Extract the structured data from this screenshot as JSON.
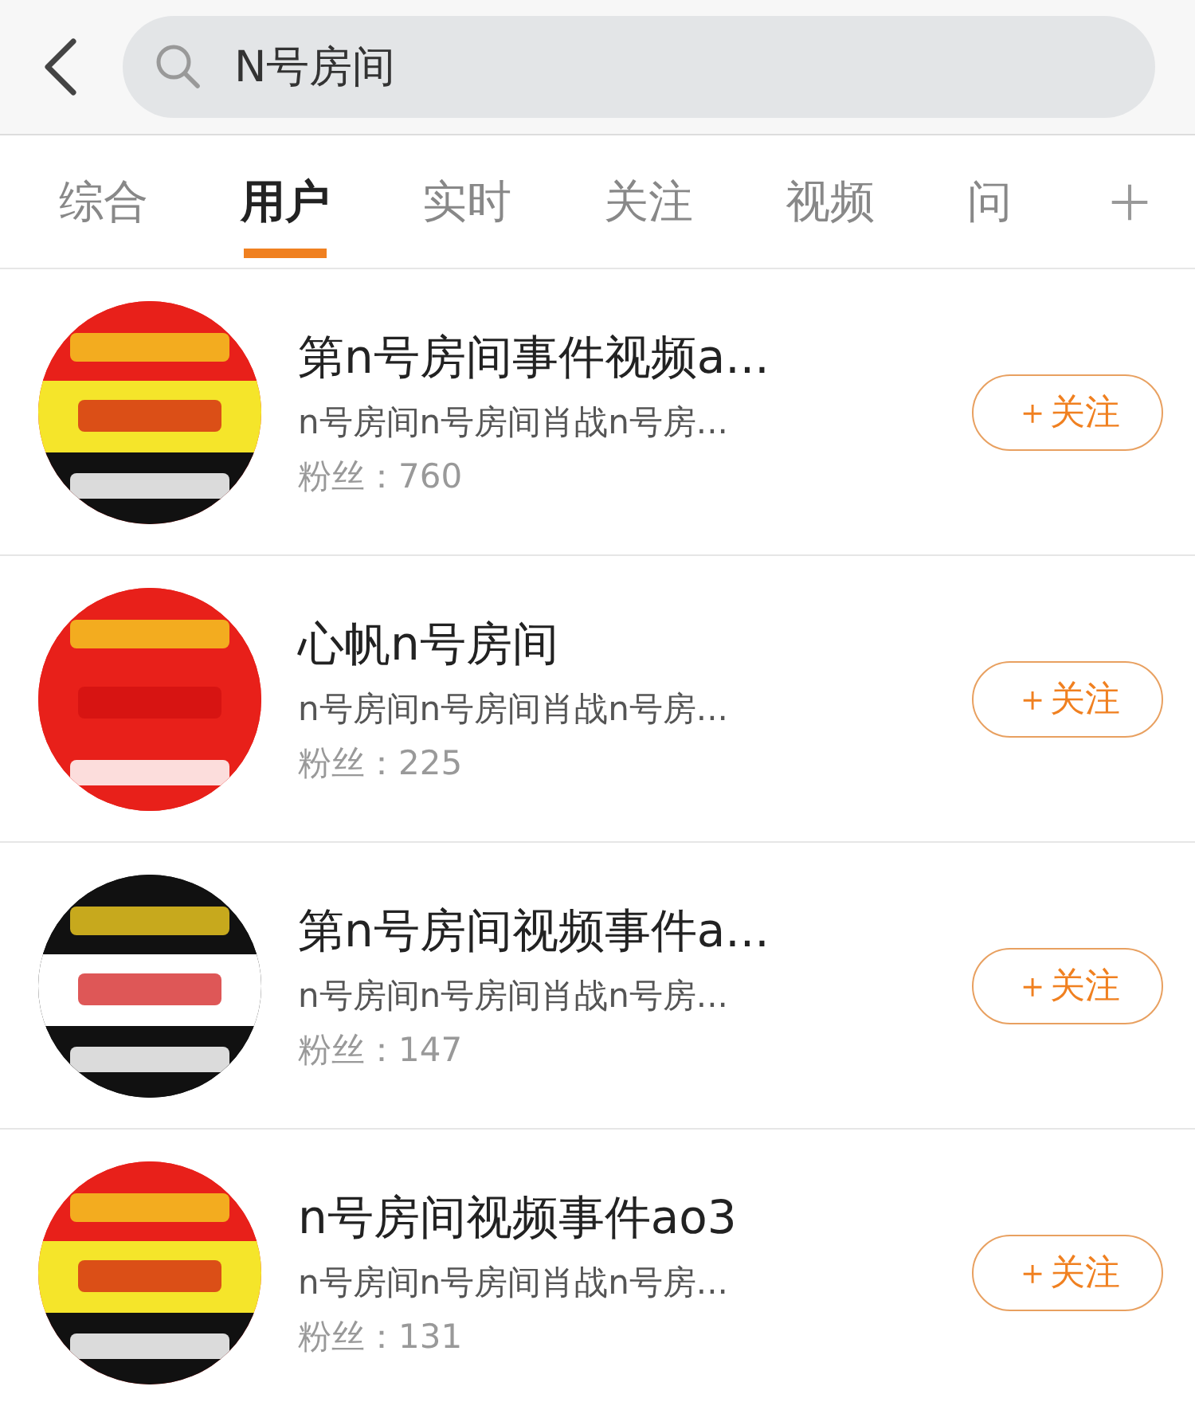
{
  "search": {
    "value": "N号房间"
  },
  "tabs": [
    {
      "label": "综合",
      "selected": false
    },
    {
      "label": "用户",
      "selected": true
    },
    {
      "label": "实时",
      "selected": false
    },
    {
      "label": "关注",
      "selected": false
    },
    {
      "label": "视频",
      "selected": false
    },
    {
      "label": "问",
      "selected": false
    }
  ],
  "users": [
    {
      "name": "第n号房间事件视频a...",
      "bio": "n号房间n号房间肖战n号房...",
      "fans": "粉丝：760",
      "follow": "＋关注"
    },
    {
      "name": "心帆n号房间",
      "bio": "n号房间n号房间肖战n号房...",
      "fans": "粉丝：225",
      "follow": "＋关注"
    },
    {
      "name": "第n号房间视频事件a...",
      "bio": "n号房间n号房间肖战n号房...",
      "fans": "粉丝：147",
      "follow": "＋关注"
    },
    {
      "name": "n号房间视频事件ao3",
      "bio": "n号房间n号房间肖战n号房...",
      "fans": "粉丝：131",
      "follow": "＋关注"
    }
  ]
}
